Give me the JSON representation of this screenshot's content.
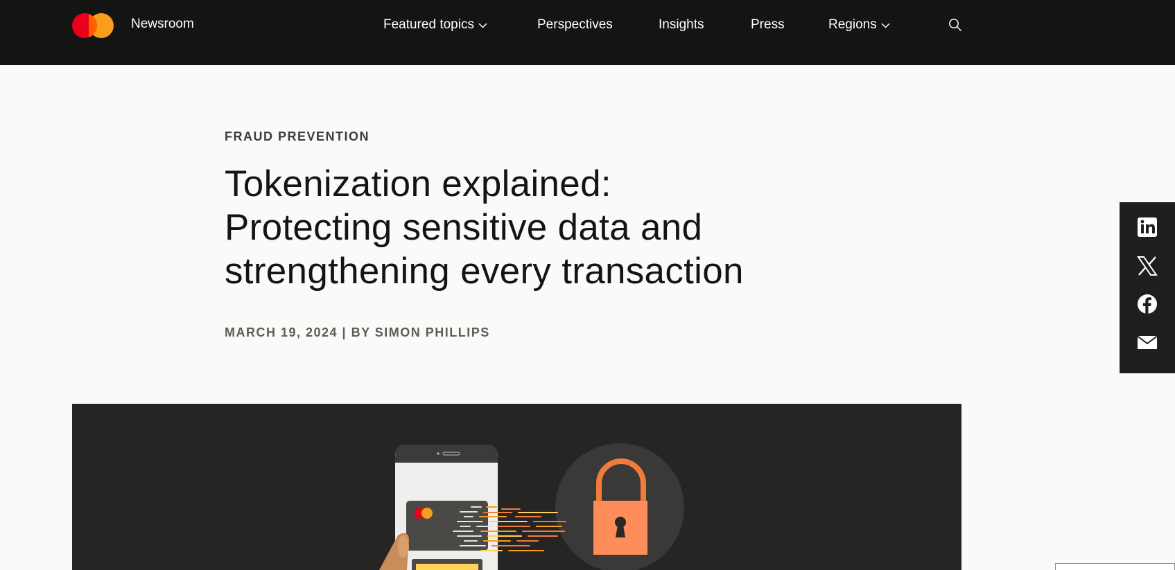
{
  "header": {
    "brand": "Newsroom",
    "nav": [
      {
        "label": "Featured topics",
        "has_dropdown": true
      },
      {
        "label": "Perspectives",
        "has_dropdown": false
      },
      {
        "label": "Insights",
        "has_dropdown": false
      },
      {
        "label": "Press",
        "has_dropdown": false
      },
      {
        "label": "Regions",
        "has_dropdown": true
      }
    ],
    "search_icon": "search-icon",
    "logo_colors": [
      "#eb001b",
      "#f79e1b",
      "#ff5f00"
    ]
  },
  "article": {
    "category": "FRAUD PREVENTION",
    "title_lines": [
      "Tokenization explained:",
      "Protecting sensitive data and",
      "strengthening every transaction"
    ],
    "byline": "MARCH 19, 2024 | BY SIMON PHILLIPS"
  },
  "share": {
    "icons": [
      "linkedin-icon",
      "x-icon",
      "facebook-icon",
      "email-icon"
    ]
  },
  "colors": {
    "header_bg": "#141413",
    "page_bg": "#fbfaf8",
    "hero_bg": "#262523",
    "accent_orange": "#f37b3a"
  }
}
